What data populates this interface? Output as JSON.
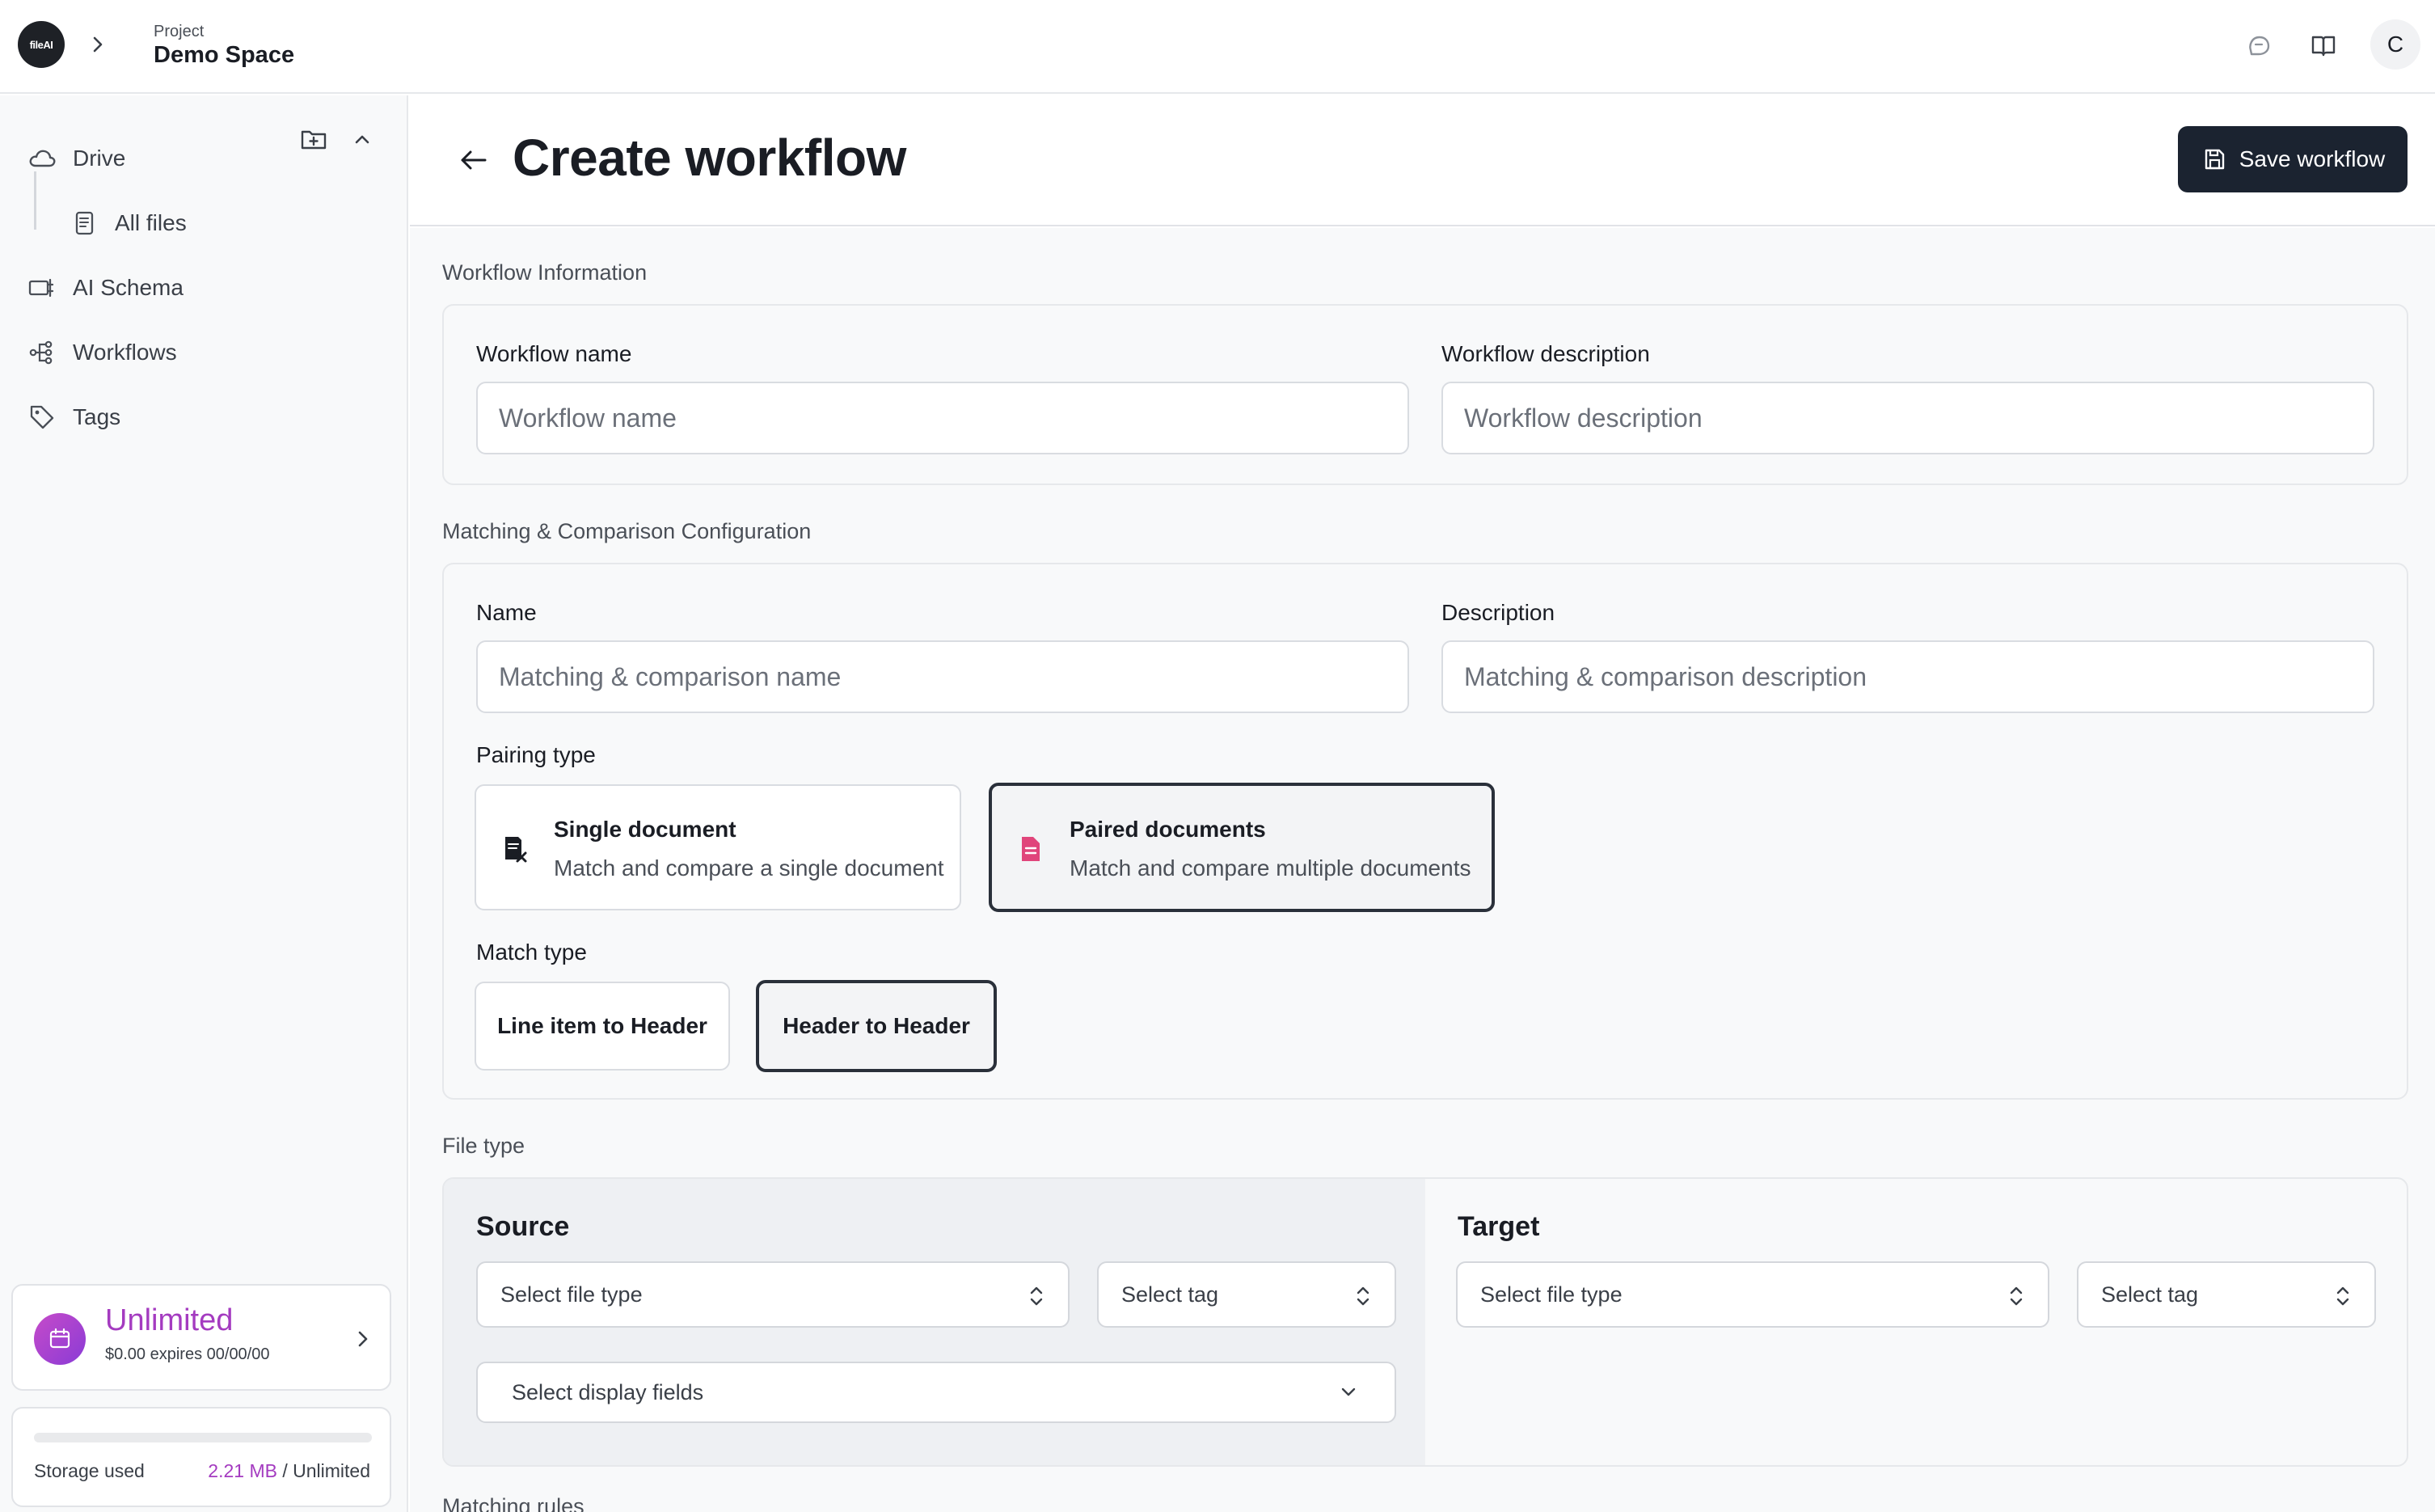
{
  "topbar": {
    "logo_text": "fileAI",
    "project_label": "Project",
    "project_name": "Demo Space",
    "avatar_letter": "C"
  },
  "sidebar": {
    "items": [
      {
        "label": "Drive",
        "icon": "cloud-icon"
      },
      {
        "label": "All files",
        "icon": "file-icon"
      },
      {
        "label": "AI Schema",
        "icon": "schema-icon"
      },
      {
        "label": "Workflows",
        "icon": "workflow-icon"
      },
      {
        "label": "Tags",
        "icon": "tag-icon"
      }
    ],
    "plan": {
      "title": "Unlimited",
      "subtitle": "$0.00 expires 00/00/00"
    },
    "storage": {
      "label": "Storage used",
      "used": "2.21 MB",
      "total": "/ Unlimited",
      "fill_fraction": 0
    }
  },
  "header": {
    "title": "Create workflow",
    "save_label": "Save workflow"
  },
  "workflow_info": {
    "section_label": "Workflow Information",
    "name_label": "Workflow name",
    "name_placeholder": "Workflow name",
    "description_label": "Workflow description",
    "description_placeholder": "Workflow description"
  },
  "matching": {
    "section_label": "Matching & Comparison Configuration",
    "name_label": "Name",
    "name_placeholder": "Matching & comparison name",
    "description_label": "Description",
    "description_placeholder": "Matching & comparison description",
    "pairing_label": "Pairing type",
    "pairing_options": [
      {
        "title": "Single document",
        "description": "Match and compare a single document",
        "selected": false
      },
      {
        "title": "Paired documents",
        "description": "Match and compare multiple documents",
        "selected": true
      }
    ],
    "match_type_label": "Match type",
    "match_type_options": [
      {
        "label": "Line item to Header",
        "selected": false
      },
      {
        "label": "Header to Header",
        "selected": true
      }
    ]
  },
  "file_type": {
    "section_label": "File type",
    "source": {
      "heading": "Source",
      "file_type_placeholder": "Select file type",
      "tag_placeholder": "Select tag",
      "display_fields_placeholder": "Select display fields"
    },
    "target": {
      "heading": "Target",
      "file_type_placeholder": "Select file type",
      "tag_placeholder": "Select tag"
    }
  },
  "matching_rules": {
    "section_label": "Matching rules"
  },
  "colors": {
    "primary_dark": "#1b2330",
    "plan_accent": "#a43bc0",
    "paired_icon": "#e0457b"
  }
}
